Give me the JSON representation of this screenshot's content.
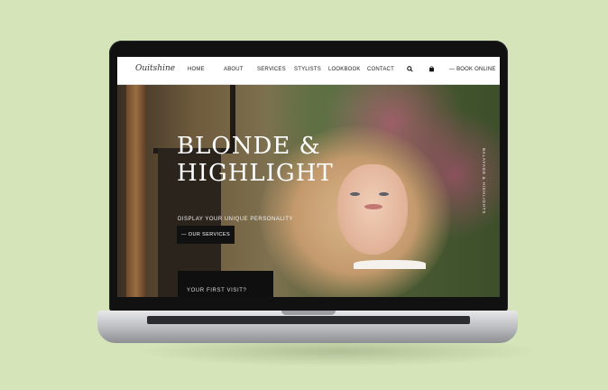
{
  "site": {
    "logo": "Ouitshine"
  },
  "nav": {
    "items": [
      {
        "label": "HOME"
      },
      {
        "label": "ABOUT"
      },
      {
        "label": "SERVICES"
      },
      {
        "label": "STYLISTS"
      },
      {
        "label": "LOOKBOOK"
      },
      {
        "label": "CONTACT"
      }
    ],
    "search_icon": "search-icon",
    "cart_icon": "bag-icon",
    "book_label": "— BOOK ONLINE"
  },
  "hero": {
    "title_line1": "BLONDE &",
    "title_line2": "HIGHLIGHT",
    "subtitle": "DISPLAY YOUR UNIQUE PERSONALITY",
    "services_button": "— OUR SERVICES",
    "first_visit_label": "YOUR FIRST VISIT?",
    "side_text": "BALAYAGE & HIGHLIGHTS"
  },
  "colors": {
    "background": "#d6e4b9",
    "nav_bg": "#ffffff",
    "button_bg": "#111111",
    "hero_text": "#ffffff"
  }
}
